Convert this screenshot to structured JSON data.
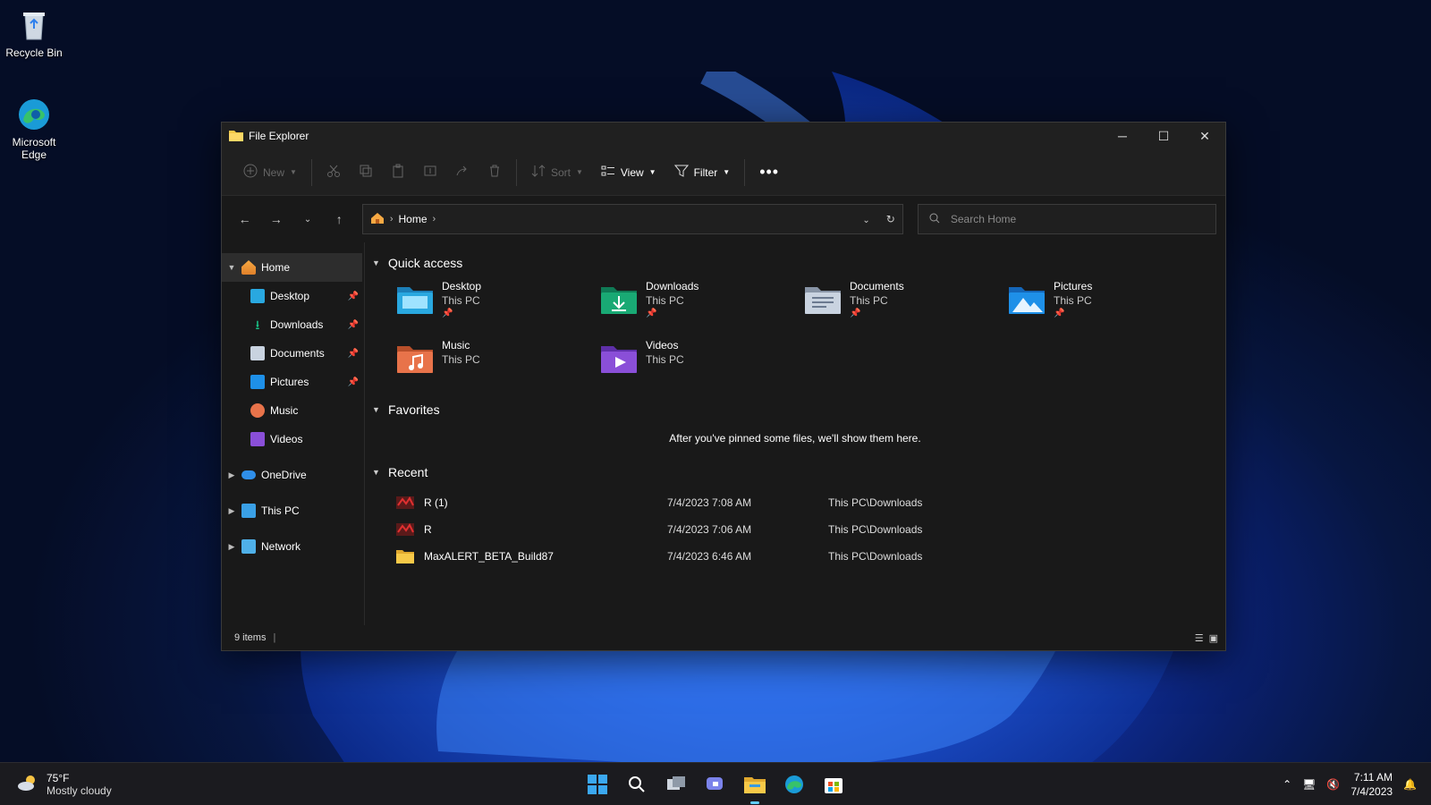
{
  "desktop": {
    "icons": [
      {
        "label": "Recycle Bin"
      },
      {
        "label": "Microsoft Edge"
      }
    ]
  },
  "window": {
    "title": "File Explorer",
    "toolbar": {
      "new_label": "New",
      "sort_label": "Sort",
      "view_label": "View",
      "filter_label": "Filter"
    },
    "address": {
      "crumb": "Home"
    },
    "search": {
      "placeholder": "Search Home"
    },
    "sidebar": {
      "home": "Home",
      "pinned": [
        {
          "label": "Desktop"
        },
        {
          "label": "Downloads"
        },
        {
          "label": "Documents"
        },
        {
          "label": "Pictures"
        },
        {
          "label": "Music"
        },
        {
          "label": "Videos"
        }
      ],
      "onedrive": "OneDrive",
      "thispc": "This PC",
      "network": "Network"
    },
    "quick_access": {
      "header": "Quick access",
      "items": [
        {
          "name": "Desktop",
          "location": "This PC"
        },
        {
          "name": "Downloads",
          "location": "This PC"
        },
        {
          "name": "Documents",
          "location": "This PC"
        },
        {
          "name": "Pictures",
          "location": "This PC"
        },
        {
          "name": "Music",
          "location": "This PC"
        },
        {
          "name": "Videos",
          "location": "This PC"
        }
      ]
    },
    "favorites": {
      "header": "Favorites",
      "empty_message": "After you've pinned some files, we'll show them here."
    },
    "recent": {
      "header": "Recent",
      "items": [
        {
          "name": "R (1)",
          "date": "7/4/2023 7:08 AM",
          "location": "This PC\\Downloads"
        },
        {
          "name": "R",
          "date": "7/4/2023 7:06 AM",
          "location": "This PC\\Downloads"
        },
        {
          "name": "MaxALERT_BETA_Build87",
          "date": "7/4/2023 6:46 AM",
          "location": "This PC\\Downloads"
        }
      ]
    },
    "status": {
      "items_count": "9 items"
    }
  },
  "taskbar": {
    "weather_temp": "75°F",
    "weather_cond": "Mostly cloudy",
    "time": "7:11 AM",
    "date": "7/4/2023"
  },
  "colors": {
    "accent": "#60cdff",
    "window_bg": "#191919",
    "desktop_folder": "#29a8e0",
    "downloads_folder": "#19a974",
    "pictures_folder": "#1e90e8",
    "music_folder": "#e8734a",
    "videos_folder": "#8a4fd8"
  }
}
